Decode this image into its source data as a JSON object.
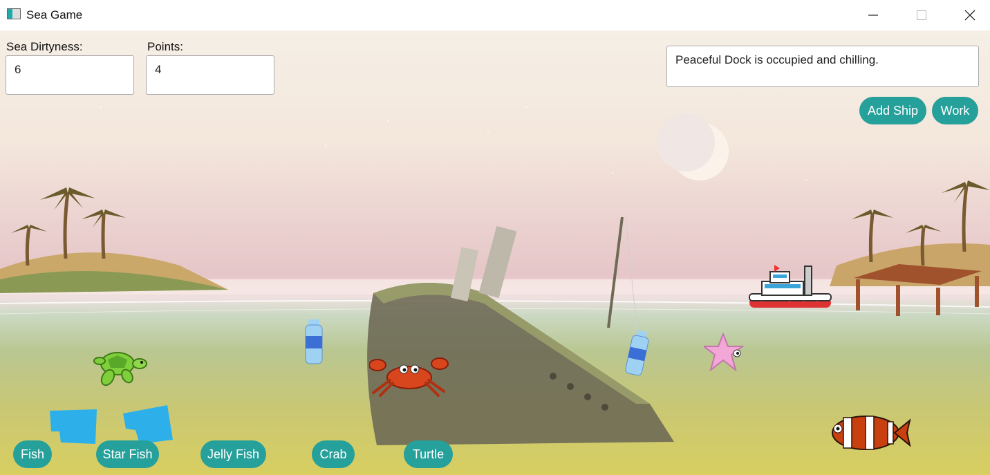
{
  "window": {
    "title": "Sea Game",
    "minimize_icon": "minimize-icon",
    "maximize_icon": "maximize-icon",
    "close_icon": "close-icon"
  },
  "stats": {
    "dirtyness_label": "Sea Dirtyness:",
    "dirtyness_value": "6",
    "points_label": "Points:",
    "points_value": "4"
  },
  "status": {
    "message": "Peaceful Dock is occupied and chilling."
  },
  "actions": {
    "add_ship": "Add Ship",
    "work": "Work"
  },
  "spawn_buttons": [
    "Fish",
    "Star Fish",
    "Jelly Fish",
    "Crab",
    "Turtle"
  ],
  "accent_color": "#26a09a"
}
